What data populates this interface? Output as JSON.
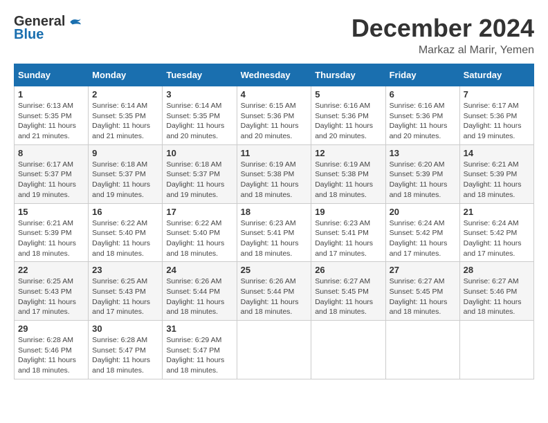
{
  "header": {
    "logo": {
      "general": "General",
      "blue": "Blue"
    },
    "title": "December 2024",
    "location": "Markaz al Marir, Yemen"
  },
  "calendar": {
    "headers": [
      "Sunday",
      "Monday",
      "Tuesday",
      "Wednesday",
      "Thursday",
      "Friday",
      "Saturday"
    ],
    "weeks": [
      [
        {
          "day": "",
          "info": ""
        },
        {
          "day": "2",
          "info": "Sunrise: 6:14 AM\nSunset: 5:35 PM\nDaylight: 11 hours\nand 21 minutes."
        },
        {
          "day": "3",
          "info": "Sunrise: 6:14 AM\nSunset: 5:35 PM\nDaylight: 11 hours\nand 20 minutes."
        },
        {
          "day": "4",
          "info": "Sunrise: 6:15 AM\nSunset: 5:36 PM\nDaylight: 11 hours\nand 20 minutes."
        },
        {
          "day": "5",
          "info": "Sunrise: 6:16 AM\nSunset: 5:36 PM\nDaylight: 11 hours\nand 20 minutes."
        },
        {
          "day": "6",
          "info": "Sunrise: 6:16 AM\nSunset: 5:36 PM\nDaylight: 11 hours\nand 20 minutes."
        },
        {
          "day": "7",
          "info": "Sunrise: 6:17 AM\nSunset: 5:36 PM\nDaylight: 11 hours\nand 19 minutes."
        }
      ],
      [
        {
          "day": "1",
          "info": "Sunrise: 6:13 AM\nSunset: 5:35 PM\nDaylight: 11 hours\nand 21 minutes."
        },
        {
          "day": "",
          "info": ""
        },
        {
          "day": "",
          "info": ""
        },
        {
          "day": "",
          "info": ""
        },
        {
          "day": "",
          "info": ""
        },
        {
          "day": "",
          "info": ""
        },
        {
          "day": "",
          "info": ""
        }
      ],
      [
        {
          "day": "8",
          "info": "Sunrise: 6:17 AM\nSunset: 5:37 PM\nDaylight: 11 hours\nand 19 minutes."
        },
        {
          "day": "9",
          "info": "Sunrise: 6:18 AM\nSunset: 5:37 PM\nDaylight: 11 hours\nand 19 minutes."
        },
        {
          "day": "10",
          "info": "Sunrise: 6:18 AM\nSunset: 5:37 PM\nDaylight: 11 hours\nand 19 minutes."
        },
        {
          "day": "11",
          "info": "Sunrise: 6:19 AM\nSunset: 5:38 PM\nDaylight: 11 hours\nand 18 minutes."
        },
        {
          "day": "12",
          "info": "Sunrise: 6:19 AM\nSunset: 5:38 PM\nDaylight: 11 hours\nand 18 minutes."
        },
        {
          "day": "13",
          "info": "Sunrise: 6:20 AM\nSunset: 5:39 PM\nDaylight: 11 hours\nand 18 minutes."
        },
        {
          "day": "14",
          "info": "Sunrise: 6:21 AM\nSunset: 5:39 PM\nDaylight: 11 hours\nand 18 minutes."
        }
      ],
      [
        {
          "day": "15",
          "info": "Sunrise: 6:21 AM\nSunset: 5:39 PM\nDaylight: 11 hours\nand 18 minutes."
        },
        {
          "day": "16",
          "info": "Sunrise: 6:22 AM\nSunset: 5:40 PM\nDaylight: 11 hours\nand 18 minutes."
        },
        {
          "day": "17",
          "info": "Sunrise: 6:22 AM\nSunset: 5:40 PM\nDaylight: 11 hours\nand 18 minutes."
        },
        {
          "day": "18",
          "info": "Sunrise: 6:23 AM\nSunset: 5:41 PM\nDaylight: 11 hours\nand 18 minutes."
        },
        {
          "day": "19",
          "info": "Sunrise: 6:23 AM\nSunset: 5:41 PM\nDaylight: 11 hours\nand 17 minutes."
        },
        {
          "day": "20",
          "info": "Sunrise: 6:24 AM\nSunset: 5:42 PM\nDaylight: 11 hours\nand 17 minutes."
        },
        {
          "day": "21",
          "info": "Sunrise: 6:24 AM\nSunset: 5:42 PM\nDaylight: 11 hours\nand 17 minutes."
        }
      ],
      [
        {
          "day": "22",
          "info": "Sunrise: 6:25 AM\nSunset: 5:43 PM\nDaylight: 11 hours\nand 17 minutes."
        },
        {
          "day": "23",
          "info": "Sunrise: 6:25 AM\nSunset: 5:43 PM\nDaylight: 11 hours\nand 17 minutes."
        },
        {
          "day": "24",
          "info": "Sunrise: 6:26 AM\nSunset: 5:44 PM\nDaylight: 11 hours\nand 18 minutes."
        },
        {
          "day": "25",
          "info": "Sunrise: 6:26 AM\nSunset: 5:44 PM\nDaylight: 11 hours\nand 18 minutes."
        },
        {
          "day": "26",
          "info": "Sunrise: 6:27 AM\nSunset: 5:45 PM\nDaylight: 11 hours\nand 18 minutes."
        },
        {
          "day": "27",
          "info": "Sunrise: 6:27 AM\nSunset: 5:45 PM\nDaylight: 11 hours\nand 18 minutes."
        },
        {
          "day": "28",
          "info": "Sunrise: 6:27 AM\nSunset: 5:46 PM\nDaylight: 11 hours\nand 18 minutes."
        }
      ],
      [
        {
          "day": "29",
          "info": "Sunrise: 6:28 AM\nSunset: 5:46 PM\nDaylight: 11 hours\nand 18 minutes."
        },
        {
          "day": "30",
          "info": "Sunrise: 6:28 AM\nSunset: 5:47 PM\nDaylight: 11 hours\nand 18 minutes."
        },
        {
          "day": "31",
          "info": "Sunrise: 6:29 AM\nSunset: 5:47 PM\nDaylight: 11 hours\nand 18 minutes."
        },
        {
          "day": "",
          "info": ""
        },
        {
          "day": "",
          "info": ""
        },
        {
          "day": "",
          "info": ""
        },
        {
          "day": "",
          "info": ""
        }
      ]
    ]
  }
}
